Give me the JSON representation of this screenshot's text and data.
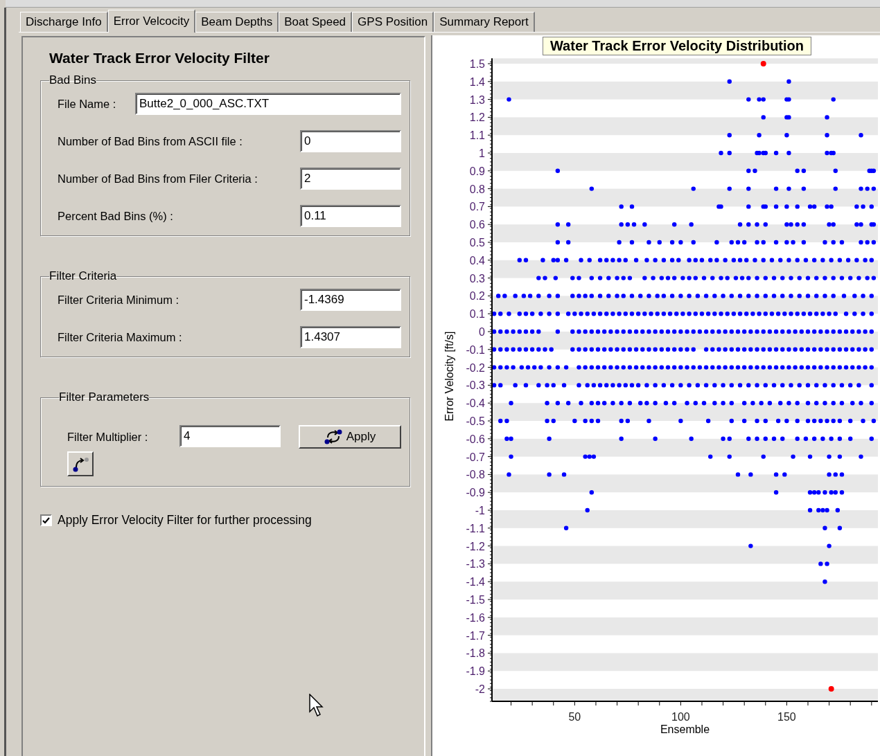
{
  "tabs": [
    {
      "label": "Discharge Info",
      "selected": false
    },
    {
      "label": "Error Velcocity",
      "selected": true
    },
    {
      "label": "Beam Depths",
      "selected": false
    },
    {
      "label": "Boat Speed",
      "selected": false
    },
    {
      "label": "GPS Position",
      "selected": false
    },
    {
      "label": "Summary Report",
      "selected": false
    }
  ],
  "filter_panel": {
    "title": "Water Track Error Velocity Filter",
    "groups": [
      {
        "legend": "Bad Bins",
        "fields": [
          {
            "kind": "wide",
            "label": "File Name :",
            "value": "Butte2_0_000_ASC.TXT"
          },
          {
            "kind": "narrow",
            "label": "Number of Bad Bins from ASCII file :",
            "value": "0"
          },
          {
            "kind": "narrow",
            "label": "Number of Bad Bins from Filer Criteria :",
            "value": "2"
          },
          {
            "kind": "narrow",
            "label": "Percent Bad Bins (%) :",
            "value": "0.11"
          }
        ]
      },
      {
        "legend": "Filter Criteria",
        "fields": [
          {
            "kind": "narrow",
            "label": "Filter Criteria Minimum :",
            "value": "-1.4369"
          },
          {
            "kind": "narrow",
            "label": "Filter Criteria Maximum :",
            "value": "1.4307"
          }
        ]
      }
    ],
    "parameters": {
      "legend": "Filter Parameters",
      "label": "Filter Multiplier :",
      "value": "4",
      "apply_button": "Apply"
    },
    "apply_filter": {
      "label": "Apply Error Velocity Filter for further processing",
      "checked": true
    }
  },
  "chart": {
    "chart_data": {
      "type": "scatter",
      "title": "Water Track Error Velocity Distribution",
      "xlabel": "Ensemble",
      "ylabel": "Error Velocity [ft/s]",
      "xlim": [
        11,
        193
      ],
      "ylim": [
        -2.07,
        1.53
      ],
      "xticks": [
        50,
        100,
        150
      ],
      "yticks": [
        -2,
        -1.9,
        -1.8,
        -1.7,
        -1.6,
        -1.5,
        -1.4,
        -1.3,
        -1.2,
        -1.1,
        -1,
        -0.9,
        -0.8,
        -0.7,
        -0.6,
        -0.5,
        -0.4,
        -0.3,
        -0.2,
        -0.1,
        0,
        0.1,
        0.2,
        0.3,
        0.4,
        0.5,
        0.6,
        0.7,
        0.8,
        0.9,
        1,
        1.1,
        1.2,
        1.3,
        1.4,
        1.5
      ],
      "series": [
        {
          "color": "#0000ff",
          "x": [
            123,
            151,
            19,
            132,
            137,
            139,
            150,
            151,
            172,
            139,
            150,
            151,
            169,
            123,
            137,
            150,
            169,
            185,
            119,
            123,
            136,
            137,
            139,
            140,
            145,
            151,
            169,
            171,
            172,
            42,
            132,
            135,
            155,
            158,
            173,
            189,
            190,
            191,
            58,
            106,
            123,
            132,
            145,
            151,
            158,
            173,
            185,
            188,
            191,
            72,
            77,
            118,
            119,
            132,
            139,
            140,
            145,
            150,
            155,
            161,
            163,
            169,
            171,
            183,
            186,
            190,
            42,
            47,
            72,
            75,
            78,
            83,
            97,
            105,
            128,
            132,
            136,
            140,
            150,
            152,
            155,
            158,
            170,
            172,
            183,
            185,
            190,
            191,
            42,
            47,
            71,
            77,
            85,
            90,
            96,
            100,
            106,
            117,
            124,
            127,
            130,
            136,
            139,
            145,
            150,
            153,
            158,
            168,
            172,
            176,
            185,
            188,
            191,
            24,
            27,
            35,
            40,
            42,
            46,
            53,
            57,
            62,
            65,
            68,
            71,
            74,
            79,
            84,
            88,
            92,
            96,
            99,
            104,
            107,
            110,
            114,
            117,
            121,
            125,
            128,
            131,
            135,
            139,
            143,
            147,
            151,
            155,
            159,
            163,
            167,
            171,
            175,
            179,
            183,
            187,
            190,
            33,
            36,
            41,
            49,
            52,
            58,
            62,
            66,
            70,
            73,
            76,
            83,
            87,
            91,
            94,
            97,
            101,
            104,
            107,
            111,
            115,
            119,
            122,
            126,
            129,
            132,
            136,
            140,
            144,
            148,
            152,
            156,
            160,
            164,
            168,
            172,
            176,
            180,
            184,
            188,
            191,
            14,
            17,
            22,
            26,
            29,
            33,
            38,
            42,
            49,
            52,
            55,
            58,
            62,
            66,
            70,
            73,
            77,
            81,
            85,
            89,
            92,
            96,
            100,
            104,
            108,
            112,
            116,
            120,
            124,
            128,
            132,
            136,
            140,
            144,
            148,
            152,
            156,
            160,
            164,
            168,
            172,
            177,
            182,
            186,
            190,
            12,
            15,
            19,
            24,
            27,
            30,
            34,
            38,
            42,
            47,
            50,
            53,
            56,
            59,
            62,
            65,
            68,
            71,
            74,
            77,
            80,
            83,
            86,
            89,
            92,
            95,
            98,
            101,
            104,
            107,
            110,
            113,
            116,
            119,
            122,
            125,
            128,
            131,
            134,
            137,
            140,
            143,
            146,
            149,
            152,
            155,
            158,
            161,
            164,
            167,
            170,
            173,
            178,
            182,
            186,
            190,
            12,
            15,
            18,
            21,
            24,
            27,
            30,
            33,
            42,
            49,
            52,
            55,
            58,
            61,
            64,
            67,
            70,
            73,
            76,
            79,
            82,
            85,
            88,
            91,
            94,
            97,
            100,
            103,
            106,
            109,
            112,
            115,
            118,
            121,
            124,
            127,
            130,
            133,
            136,
            139,
            142,
            145,
            148,
            151,
            154,
            157,
            160,
            163,
            166,
            169,
            172,
            175,
            178,
            181,
            184,
            187,
            190,
            12,
            15,
            18,
            21,
            24,
            27,
            30,
            33,
            36,
            39,
            49,
            52,
            55,
            58,
            61,
            64,
            67,
            70,
            73,
            76,
            79,
            82,
            85,
            88,
            91,
            94,
            97,
            100,
            103,
            106,
            112,
            115,
            118,
            121,
            124,
            127,
            130,
            133,
            136,
            139,
            142,
            145,
            148,
            151,
            154,
            157,
            160,
            163,
            166,
            169,
            172,
            175,
            178,
            181,
            184,
            187,
            190,
            12,
            15,
            18,
            21,
            25,
            28,
            31,
            34,
            38,
            42,
            46,
            52,
            55,
            58,
            61,
            64,
            67,
            70,
            73,
            76,
            79,
            82,
            85,
            88,
            91,
            94,
            97,
            100,
            103,
            106,
            109,
            112,
            115,
            118,
            121,
            124,
            127,
            130,
            133,
            136,
            139,
            142,
            145,
            148,
            151,
            154,
            157,
            160,
            163,
            166,
            169,
            172,
            175,
            178,
            181,
            184,
            187,
            190,
            12,
            15,
            22,
            27,
            33,
            37,
            40,
            45,
            52,
            56,
            59,
            62,
            65,
            68,
            71,
            74,
            77,
            80,
            84,
            88,
            92,
            96,
            100,
            104,
            108,
            112,
            116,
            120,
            124,
            128,
            132,
            136,
            140,
            144,
            148,
            152,
            156,
            160,
            164,
            168,
            172,
            176,
            180,
            184,
            190,
            20,
            37,
            42,
            47,
            53,
            58,
            61,
            64,
            68,
            72,
            76,
            81,
            84,
            88,
            93,
            97,
            103,
            107,
            111,
            116,
            120,
            124,
            130,
            134,
            138,
            142,
            147,
            151,
            155,
            160,
            164,
            168,
            172,
            176,
            181,
            185,
            190,
            15,
            18,
            37,
            40,
            50,
            55,
            58,
            61,
            72,
            75,
            85,
            100,
            113,
            124,
            130,
            136,
            140,
            146,
            150,
            155,
            160,
            163,
            166,
            169,
            172,
            175,
            180,
            186,
            191,
            18,
            20,
            38,
            72,
            88,
            105,
            120,
            123,
            132,
            136,
            140,
            144,
            148,
            155,
            159,
            163,
            167,
            171,
            175,
            180,
            190,
            20,
            55,
            57,
            59,
            114,
            123,
            139,
            153,
            161,
            170,
            175,
            185,
            19,
            38,
            45,
            127,
            133,
            145,
            149,
            170,
            173,
            176,
            58,
            145,
            161,
            163,
            165,
            168,
            171,
            173,
            176,
            56,
            161,
            165,
            167,
            169,
            174,
            46,
            168,
            175,
            133,
            170,
            166,
            169,
            168
          ],
          "values": [
            1.4,
            1.4,
            1.3,
            1.3,
            1.3,
            1.3,
            1.3,
            1.3,
            1.3,
            1.2,
            1.2,
            1.2,
            1.2,
            1.1,
            1.1,
            1.1,
            1.1,
            1.1,
            1,
            1,
            1,
            1,
            1,
            1,
            1,
            1,
            1,
            1,
            1,
            0.9,
            0.9,
            0.9,
            0.9,
            0.9,
            0.9,
            0.9,
            0.9,
            0.9,
            0.8,
            0.8,
            0.8,
            0.8,
            0.8,
            0.8,
            0.8,
            0.8,
            0.8,
            0.8,
            0.8,
            0.7,
            0.7,
            0.7,
            0.7,
            0.7,
            0.7,
            0.7,
            0.7,
            0.7,
            0.7,
            0.7,
            0.7,
            0.7,
            0.7,
            0.7,
            0.7,
            0.7,
            0.6,
            0.6,
            0.6,
            0.6,
            0.6,
            0.6,
            0.6,
            0.6,
            0.6,
            0.6,
            0.6,
            0.6,
            0.6,
            0.6,
            0.6,
            0.6,
            0.6,
            0.6,
            0.6,
            0.6,
            0.6,
            0.6,
            0.5,
            0.5,
            0.5,
            0.5,
            0.5,
            0.5,
            0.5,
            0.5,
            0.5,
            0.5,
            0.5,
            0.5,
            0.5,
            0.5,
            0.5,
            0.5,
            0.5,
            0.5,
            0.5,
            0.5,
            0.5,
            0.5,
            0.5,
            0.5,
            0.5,
            0.4,
            0.4,
            0.4,
            0.4,
            0.4,
            0.4,
            0.4,
            0.4,
            0.4,
            0.4,
            0.4,
            0.4,
            0.4,
            0.4,
            0.4,
            0.4,
            0.4,
            0.4,
            0.4,
            0.4,
            0.4,
            0.4,
            0.4,
            0.4,
            0.4,
            0.4,
            0.4,
            0.4,
            0.4,
            0.4,
            0.4,
            0.4,
            0.4,
            0.4,
            0.4,
            0.4,
            0.4,
            0.4,
            0.4,
            0.4,
            0.4,
            0.4,
            0.4,
            0.3,
            0.3,
            0.3,
            0.3,
            0.3,
            0.3,
            0.3,
            0.3,
            0.3,
            0.3,
            0.3,
            0.3,
            0.3,
            0.3,
            0.3,
            0.3,
            0.3,
            0.3,
            0.3,
            0.3,
            0.3,
            0.3,
            0.3,
            0.3,
            0.3,
            0.3,
            0.3,
            0.3,
            0.3,
            0.3,
            0.3,
            0.3,
            0.3,
            0.3,
            0.3,
            0.3,
            0.3,
            0.3,
            0.3,
            0.3,
            0.3,
            0.2,
            0.2,
            0.2,
            0.2,
            0.2,
            0.2,
            0.2,
            0.2,
            0.2,
            0.2,
            0.2,
            0.2,
            0.2,
            0.2,
            0.2,
            0.2,
            0.2,
            0.2,
            0.2,
            0.2,
            0.2,
            0.2,
            0.2,
            0.2,
            0.2,
            0.2,
            0.2,
            0.2,
            0.2,
            0.2,
            0.2,
            0.2,
            0.2,
            0.2,
            0.2,
            0.2,
            0.2,
            0.2,
            0.2,
            0.2,
            0.2,
            0.2,
            0.2,
            0.2,
            0.2,
            0.1,
            0.1,
            0.1,
            0.1,
            0.1,
            0.1,
            0.1,
            0.1,
            0.1,
            0.1,
            0.1,
            0.1,
            0.1,
            0.1,
            0.1,
            0.1,
            0.1,
            0.1,
            0.1,
            0.1,
            0.1,
            0.1,
            0.1,
            0.1,
            0.1,
            0.1,
            0.1,
            0.1,
            0.1,
            0.1,
            0.1,
            0.1,
            0.1,
            0.1,
            0.1,
            0.1,
            0.1,
            0.1,
            0.1,
            0.1,
            0.1,
            0.1,
            0.1,
            0.1,
            0.1,
            0.1,
            0.1,
            0.1,
            0.1,
            0.1,
            0.1,
            0.1,
            0.1,
            0.1,
            0.1,
            0.1,
            0,
            0,
            0,
            0,
            0,
            0,
            0,
            0,
            0,
            0,
            0,
            0,
            0,
            0,
            0,
            0,
            0,
            0,
            0,
            0,
            0,
            0,
            0,
            0,
            0,
            0,
            0,
            0,
            0,
            0,
            0,
            0,
            0,
            0,
            0,
            0,
            0,
            0,
            0,
            0,
            0,
            0,
            0,
            0,
            0,
            0,
            0,
            0,
            0,
            0,
            0,
            0,
            0,
            0,
            0,
            0,
            0,
            -0.1,
            -0.1,
            -0.1,
            -0.1,
            -0.1,
            -0.1,
            -0.1,
            -0.1,
            -0.1,
            -0.1,
            -0.1,
            -0.1,
            -0.1,
            -0.1,
            -0.1,
            -0.1,
            -0.1,
            -0.1,
            -0.1,
            -0.1,
            -0.1,
            -0.1,
            -0.1,
            -0.1,
            -0.1,
            -0.1,
            -0.1,
            -0.1,
            -0.1,
            -0.1,
            -0.1,
            -0.1,
            -0.1,
            -0.1,
            -0.1,
            -0.1,
            -0.1,
            -0.1,
            -0.1,
            -0.1,
            -0.1,
            -0.1,
            -0.1,
            -0.1,
            -0.1,
            -0.1,
            -0.1,
            -0.1,
            -0.1,
            -0.1,
            -0.1,
            -0.1,
            -0.1,
            -0.1,
            -0.1,
            -0.1,
            -0.1,
            -0.2,
            -0.2,
            -0.2,
            -0.2,
            -0.2,
            -0.2,
            -0.2,
            -0.2,
            -0.2,
            -0.2,
            -0.2,
            -0.2,
            -0.2,
            -0.2,
            -0.2,
            -0.2,
            -0.2,
            -0.2,
            -0.2,
            -0.2,
            -0.2,
            -0.2,
            -0.2,
            -0.2,
            -0.2,
            -0.2,
            -0.2,
            -0.2,
            -0.2,
            -0.2,
            -0.2,
            -0.2,
            -0.2,
            -0.2,
            -0.2,
            -0.2,
            -0.2,
            -0.2,
            -0.2,
            -0.2,
            -0.2,
            -0.2,
            -0.2,
            -0.2,
            -0.2,
            -0.2,
            -0.2,
            -0.2,
            -0.2,
            -0.2,
            -0.2,
            -0.2,
            -0.2,
            -0.2,
            -0.2,
            -0.2,
            -0.2,
            -0.2,
            -0.3,
            -0.3,
            -0.3,
            -0.3,
            -0.3,
            -0.3,
            -0.3,
            -0.3,
            -0.3,
            -0.3,
            -0.3,
            -0.3,
            -0.3,
            -0.3,
            -0.3,
            -0.3,
            -0.3,
            -0.3,
            -0.3,
            -0.3,
            -0.3,
            -0.3,
            -0.3,
            -0.3,
            -0.3,
            -0.3,
            -0.3,
            -0.3,
            -0.3,
            -0.3,
            -0.3,
            -0.3,
            -0.3,
            -0.3,
            -0.3,
            -0.3,
            -0.3,
            -0.3,
            -0.3,
            -0.3,
            -0.3,
            -0.3,
            -0.3,
            -0.3,
            -0.3,
            -0.4,
            -0.4,
            -0.4,
            -0.4,
            -0.4,
            -0.4,
            -0.4,
            -0.4,
            -0.4,
            -0.4,
            -0.4,
            -0.4,
            -0.4,
            -0.4,
            -0.4,
            -0.4,
            -0.4,
            -0.4,
            -0.4,
            -0.4,
            -0.4,
            -0.4,
            -0.4,
            -0.4,
            -0.4,
            -0.4,
            -0.4,
            -0.4,
            -0.4,
            -0.4,
            -0.4,
            -0.4,
            -0.4,
            -0.4,
            -0.4,
            -0.4,
            -0.4,
            -0.5,
            -0.5,
            -0.5,
            -0.5,
            -0.5,
            -0.5,
            -0.5,
            -0.5,
            -0.5,
            -0.5,
            -0.5,
            -0.5,
            -0.5,
            -0.5,
            -0.5,
            -0.5,
            -0.5,
            -0.5,
            -0.5,
            -0.5,
            -0.5,
            -0.5,
            -0.5,
            -0.5,
            -0.5,
            -0.5,
            -0.5,
            -0.5,
            -0.5,
            -0.6,
            -0.6,
            -0.6,
            -0.6,
            -0.6,
            -0.6,
            -0.6,
            -0.6,
            -0.6,
            -0.6,
            -0.6,
            -0.6,
            -0.6,
            -0.6,
            -0.6,
            -0.6,
            -0.6,
            -0.6,
            -0.6,
            -0.6,
            -0.6,
            -0.7,
            -0.7,
            -0.7,
            -0.7,
            -0.7,
            -0.7,
            -0.7,
            -0.7,
            -0.7,
            -0.7,
            -0.7,
            -0.7,
            -0.8,
            -0.8,
            -0.8,
            -0.8,
            -0.8,
            -0.8,
            -0.8,
            -0.8,
            -0.8,
            -0.8,
            -0.9,
            -0.9,
            -0.9,
            -0.9,
            -0.9,
            -0.9,
            -0.9,
            -0.9,
            -0.9,
            -1,
            -1,
            -1,
            -1,
            -1,
            -1,
            -1.1,
            -1.1,
            -1.1,
            -1.2,
            -1.2,
            -1.3,
            -1.3,
            -1.4
          ]
        },
        {
          "color": "#ff0000",
          "x": [
            139,
            171
          ],
          "values": [
            1.5,
            -2
          ]
        }
      ]
    }
  }
}
